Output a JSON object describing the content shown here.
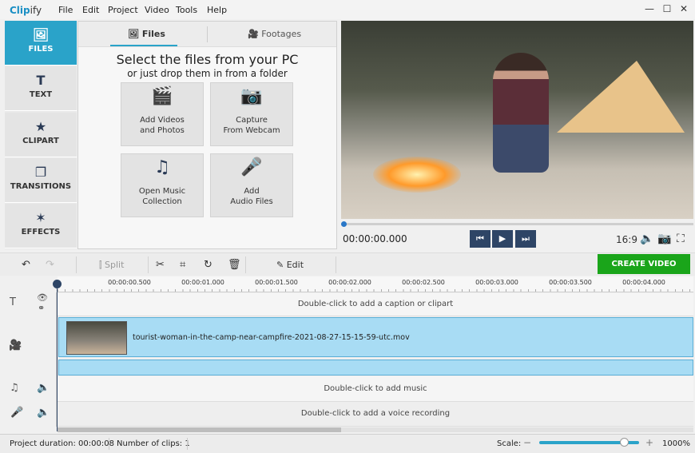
{
  "app": {
    "logo_a": "Clip",
    "logo_b": "ify"
  },
  "menu": [
    "File",
    "Edit",
    "Project",
    "Video",
    "Tools",
    "Help"
  ],
  "window": {
    "minimize": "—",
    "maximize": "☐",
    "close": "✕"
  },
  "sidebar": [
    {
      "label": "FILES",
      "icon": "🖼"
    },
    {
      "label": "TEXT",
      "icon": "T"
    },
    {
      "label": "CLIPART",
      "icon": "★"
    },
    {
      "label": "TRANSITIONS",
      "icon": "❐"
    },
    {
      "label": "EFFECTS",
      "icon": "✶"
    }
  ],
  "panel": {
    "tabs": [
      {
        "label": "Files",
        "icon": "🖼"
      },
      {
        "label": "Footages",
        "icon": "🎥"
      }
    ],
    "heading": "Select the files from your PC",
    "subheading": "or just drop them in from a folder",
    "tiles": [
      {
        "l1": "Add Videos",
        "l2": "and Photos",
        "icon": "🎬"
      },
      {
        "l1": "Capture",
        "l2": "From Webcam",
        "icon": "📷"
      },
      {
        "l1": "Open Music",
        "l2": "Collection",
        "icon": "♫"
      },
      {
        "l1": "Add",
        "l2": "Audio Files",
        "icon": "🎤"
      }
    ]
  },
  "player": {
    "timecode": "00:00:00.000",
    "prev": "⏮",
    "play": "▶",
    "next": "⏭",
    "aspect": "16:9",
    "volume": "🔈",
    "snapshot": "📷",
    "fullscreen": "⛶",
    "progress": 0
  },
  "toolbar": {
    "undo": "↶",
    "redo": "↷",
    "split": "Split",
    "cut": "✂",
    "crop": "⌗",
    "rotate": "↻",
    "delete": "🗑",
    "edit": "Edit",
    "create": "CREATE VIDEO"
  },
  "ruler": [
    "00:00:00.500",
    "00:00:01.000",
    "00:00:01.500",
    "00:00:02.000",
    "00:00:02.500",
    "00:00:03.000",
    "00:00:03.500",
    "00:00:04.000"
  ],
  "tracks": {
    "caption": "Double-click to add a caption or clipart",
    "clip": "tourist-woman-in-the-camp-near-campfire-2021-08-27-15-15-59-utc.mov",
    "music": "Double-click to add music",
    "voice": "Double-click to add a voice recording"
  },
  "status": {
    "duration": "Project duration:  00:00:08",
    "clips": "Number of clips: 1",
    "scale_label": "Scale:",
    "minus": "−",
    "plus": "+",
    "zoom": "1000%",
    "scale_level": 0.85
  }
}
